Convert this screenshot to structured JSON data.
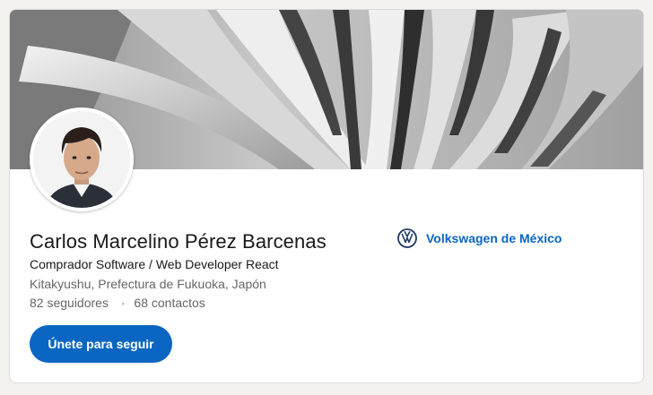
{
  "profile": {
    "name": "Carlos Marcelino Pérez Barcenas",
    "headline": "Comprador Software / Web Developer React",
    "location": "Kitakyushu, Prefectura de Fukuoka, Japón",
    "followers": "82 seguidores",
    "separator": "·",
    "connections": "68 contactos"
  },
  "actions": {
    "follow_label": "Únete para seguir"
  },
  "company": {
    "name": "Volkswagen de México",
    "icon": "volkswagen-logo-icon"
  },
  "colors": {
    "accent": "#0a66c2",
    "banner": "#a9a9a9"
  }
}
